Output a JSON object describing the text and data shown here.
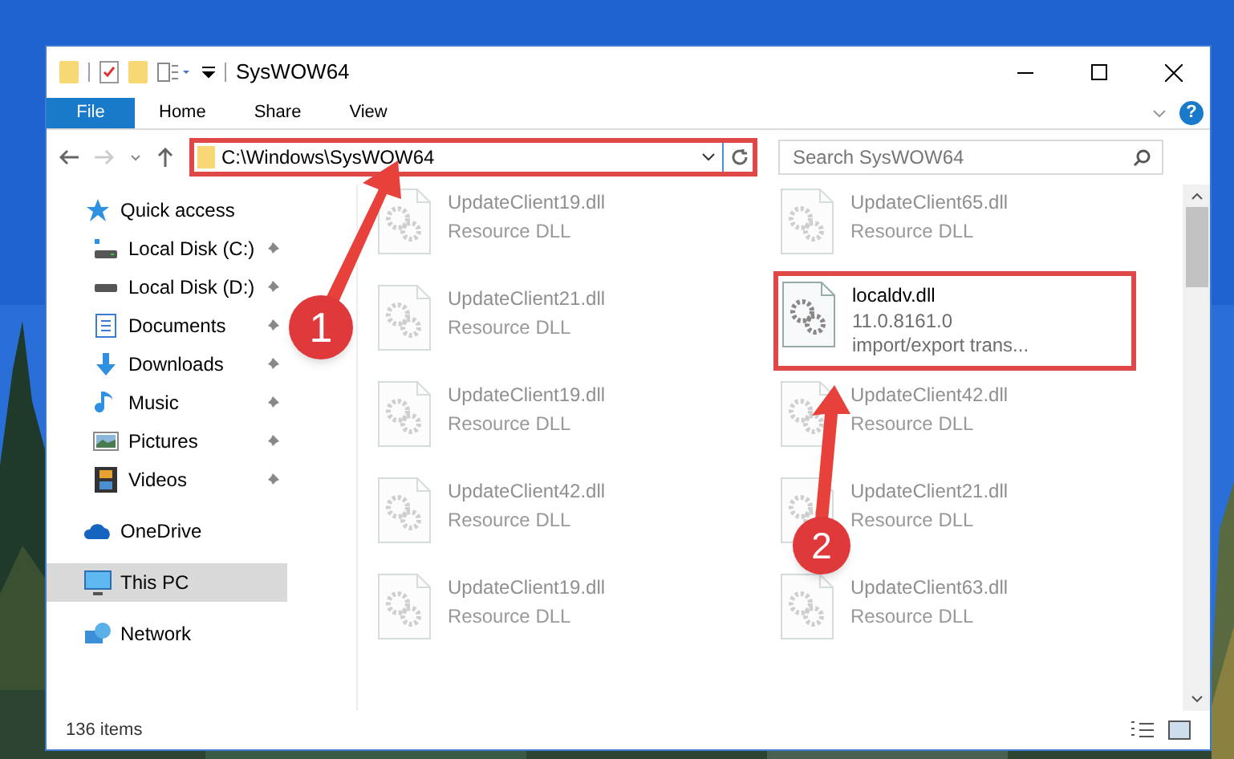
{
  "window": {
    "title": "SysWOW64"
  },
  "ribbon_tabs": [
    {
      "label": "File",
      "selected": true
    },
    {
      "label": "Home",
      "selected": false
    },
    {
      "label": "Share",
      "selected": false
    },
    {
      "label": "View",
      "selected": false
    }
  ],
  "help": {
    "label": "?"
  },
  "address": {
    "path": "C:\\Windows\\SysWOW64",
    "highlighted": true
  },
  "search": {
    "placeholder": "Search SysWOW64"
  },
  "sidebar": {
    "items": [
      {
        "label": "Quick access",
        "kind": "section",
        "pinned": false,
        "selected": false
      },
      {
        "label": "Local Disk (C:)",
        "kind": "entry",
        "pinned": true,
        "selected": false
      },
      {
        "label": "Local Disk (D:)",
        "kind": "entry",
        "pinned": true,
        "selected": false
      },
      {
        "label": "Documents",
        "kind": "entry",
        "pinned": true,
        "selected": false
      },
      {
        "label": "Downloads",
        "kind": "entry",
        "pinned": true,
        "selected": false
      },
      {
        "label": "Music",
        "kind": "entry",
        "pinned": true,
        "selected": false
      },
      {
        "label": "Pictures",
        "kind": "entry",
        "pinned": true,
        "selected": false
      },
      {
        "label": "Videos",
        "kind": "entry",
        "pinned": true,
        "selected": false
      },
      {
        "label": "OneDrive",
        "kind": "section",
        "pinned": false,
        "selected": false
      },
      {
        "label": "This PC",
        "kind": "section",
        "pinned": false,
        "selected": true
      },
      {
        "label": "Network",
        "kind": "section",
        "pinned": false,
        "selected": false
      }
    ]
  },
  "files": [
    {
      "name": "UpdateClient19.dll",
      "lines": [
        "Resource DLL"
      ],
      "highlighted": false
    },
    {
      "name": "UpdateClient65.dll",
      "lines": [
        "Resource DLL"
      ],
      "highlighted": false
    },
    {
      "name": "UpdateClient21.dll",
      "lines": [
        "Resource DLL"
      ],
      "highlighted": false
    },
    {
      "name": "localdv.dll",
      "lines": [
        "11.0.8161.0",
        "import/export trans..."
      ],
      "highlighted": true
    },
    {
      "name": "UpdateClient19.dll",
      "lines": [
        "Resource DLL"
      ],
      "highlighted": false
    },
    {
      "name": "UpdateClient42.dll",
      "lines": [
        "Resource DLL"
      ],
      "highlighted": false
    },
    {
      "name": "UpdateClient42.dll",
      "lines": [
        "Resource DLL"
      ],
      "highlighted": false
    },
    {
      "name": "UpdateClient21.dll",
      "lines": [
        "Resource DLL"
      ],
      "highlighted": false
    },
    {
      "name": "UpdateClient19.dll",
      "lines": [
        "Resource DLL"
      ],
      "highlighted": false
    },
    {
      "name": "UpdateClient63.dll",
      "lines": [
        "Resource DLL"
      ],
      "highlighted": false
    }
  ],
  "status_bar": {
    "count": "136 items"
  },
  "callouts": [
    {
      "number": "1"
    },
    {
      "number": "2"
    }
  ]
}
